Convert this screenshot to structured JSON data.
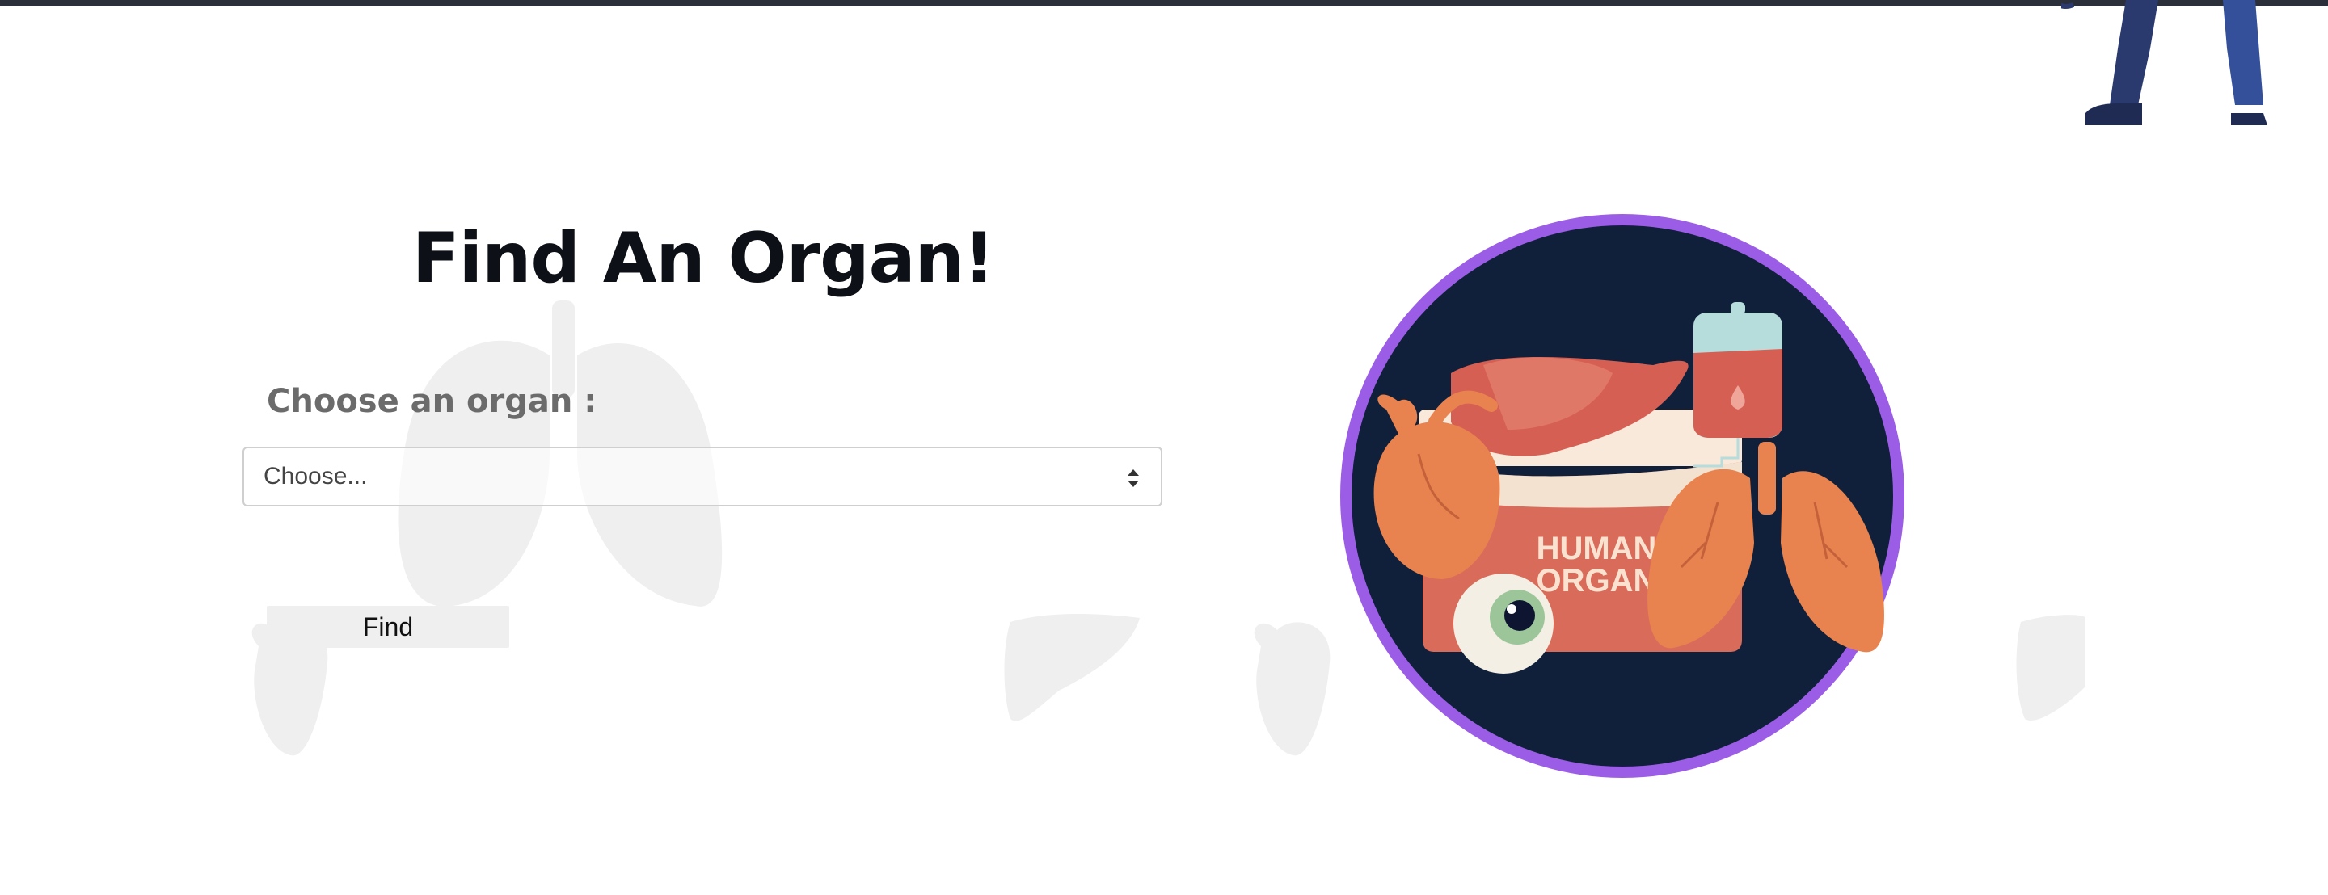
{
  "page": {
    "title": "Find An Organ!",
    "choose_label": "Choose an organ :",
    "select": {
      "selected": "Choose..."
    },
    "find_button": "Find"
  },
  "illustration": {
    "text_line1": "HUMAN",
    "text_line2": "ORGAN"
  },
  "colors": {
    "topbar": "#2b2f3a",
    "title": "#0d1117",
    "label": "#6b6b6b",
    "circle_bg": "#10203a",
    "circle_ring": "#9b5de5",
    "box": "#d96b5a",
    "organ_orange": "#e8834f"
  }
}
